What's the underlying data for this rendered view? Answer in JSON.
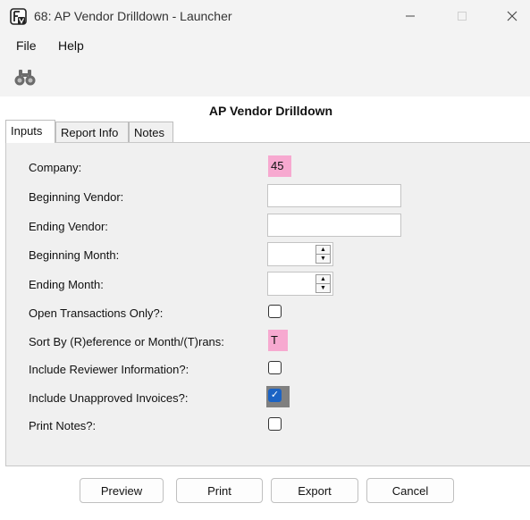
{
  "window": {
    "title": "68: AP Vendor Drilldown - Launcher",
    "icon": "app-logo-icon",
    "controls": [
      "minimize-icon",
      "maximize-icon",
      "close-icon"
    ]
  },
  "menubar": {
    "items": [
      "File",
      "Help"
    ]
  },
  "toolbar": {
    "find_icon": "binoculars-icon"
  },
  "report_title": "AP Vendor Drilldown",
  "tabs": [
    "Inputs",
    "Report Info",
    "Notes"
  ],
  "active_tab": "Inputs",
  "form": {
    "company": {
      "label": "Company:",
      "value": "45"
    },
    "beginning_vendor": {
      "label": "Beginning Vendor:",
      "value": ""
    },
    "ending_vendor": {
      "label": "Ending Vendor:",
      "value": ""
    },
    "beginning_month": {
      "label": "Beginning Month:",
      "value": ""
    },
    "ending_month": {
      "label": "Ending Month:",
      "value": ""
    },
    "open_transactions_only": {
      "label": "Open Transactions Only?:",
      "checked": false
    },
    "sort_by": {
      "label": "Sort By (R)eference or Month/(T)rans:",
      "value": "T"
    },
    "include_reviewer_info": {
      "label": "Include Reviewer Information?:",
      "checked": false
    },
    "include_unapproved_invoices": {
      "label": "Include Unapproved Invoices?:",
      "checked": true
    },
    "print_notes": {
      "label": "Print Notes?:",
      "checked": false
    }
  },
  "buttons": {
    "preview": "Preview",
    "print": "Print",
    "export": "Export",
    "cancel": "Cancel"
  },
  "colors": {
    "required_field": "#f7a9d0",
    "checkbox_checked": "#1b63c4",
    "chrome": "#f3f3f3"
  }
}
